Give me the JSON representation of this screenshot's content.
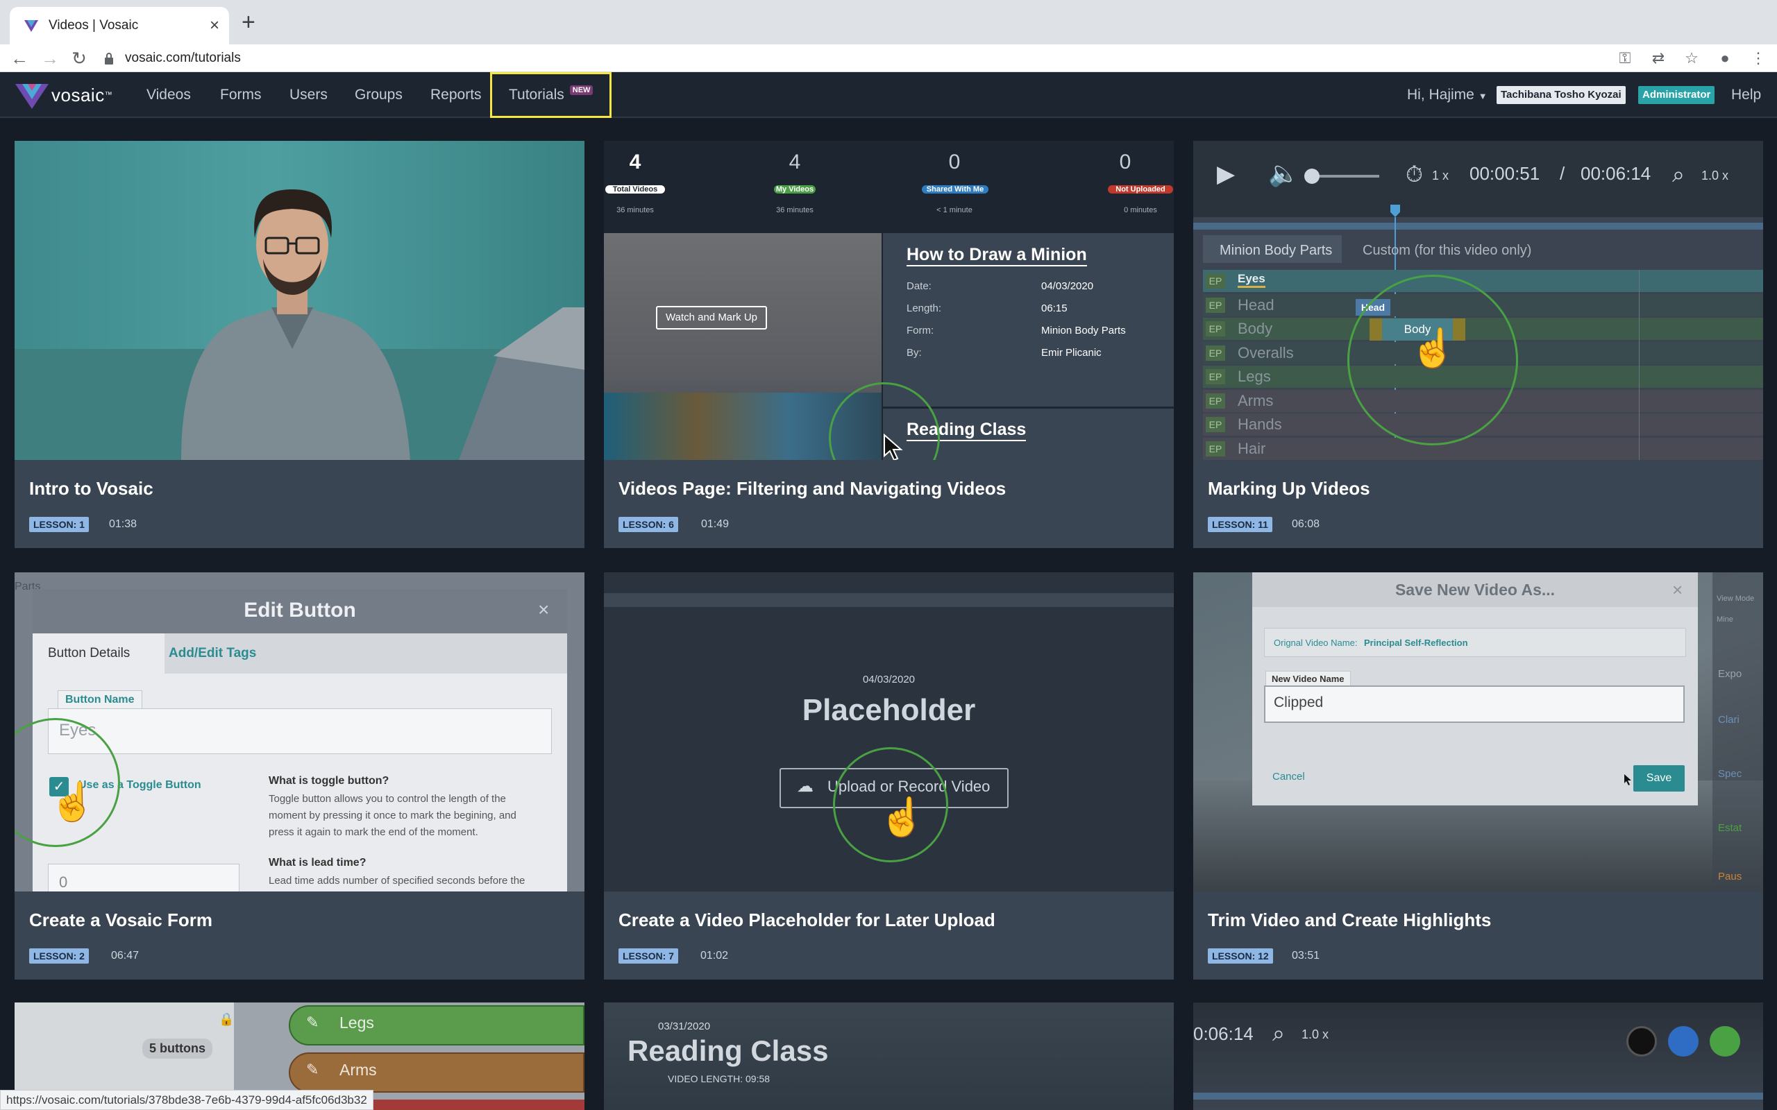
{
  "browser": {
    "tab_title": "Videos | Vosaic",
    "url": "vosaic.com/tutorials",
    "status_url": "https://vosaic.com/tutorials/378bde38-7e6b-4379-99d4-af5fc06d3b32"
  },
  "app": {
    "logo": "vosaic",
    "nav": [
      "Videos",
      "Forms",
      "Users",
      "Groups",
      "Reports"
    ],
    "tutorials_label": "Tutorials",
    "tutorials_badge": "NEW",
    "user_greeting": "Hi, Hajime",
    "org_badge": "Tachibana Tosho Kyozai",
    "role_badge": "Administrator",
    "help": "Help"
  },
  "cards": [
    {
      "title": "Intro to Vosaic",
      "lesson": "LESSON: 1",
      "duration": "01:38"
    },
    {
      "title": "Videos Page: Filtering and Navigating Videos",
      "lesson": "LESSON: 6",
      "duration": "01:49"
    },
    {
      "title": "Marking Up Videos",
      "lesson": "LESSON: 11",
      "duration": "06:08"
    },
    {
      "title": "Create a Vosaic Form",
      "lesson": "LESSON: 2",
      "duration": "06:47"
    },
    {
      "title": "Create a Video Placeholder for Later Upload",
      "lesson": "LESSON: 7",
      "duration": "01:02"
    },
    {
      "title": "Trim Video and Create Highlights",
      "lesson": "LESSON: 12",
      "duration": "03:51"
    }
  ],
  "thumbs": {
    "videos_page": {
      "stats": [
        {
          "num": "4",
          "label": "Total Videos",
          "sub": "36 minutes"
        },
        {
          "num": "4",
          "label": "My Videos",
          "sub": "36 minutes"
        },
        {
          "num": "0",
          "label": "Shared With Me",
          "sub": "< 1 minute"
        },
        {
          "num": "0",
          "label": "Not Uploaded",
          "sub": "0 minutes"
        }
      ],
      "watch_btn": "Watch and Mark Up",
      "video_title": "How to Draw a Minion",
      "details": [
        {
          "k": "Date:",
          "v": "04/03/2020"
        },
        {
          "k": "Length:",
          "v": "06:15"
        },
        {
          "k": "Form:",
          "v": "Minion Body Parts"
        },
        {
          "k": "By:",
          "v": "Emir Plicanic"
        }
      ],
      "next_title": "Reading Class"
    },
    "markup": {
      "speed": "1 x",
      "time": "00:00:51",
      "sep": "/",
      "total": "00:06:14",
      "zoom": "1.0 x",
      "tab1": "Minion Body Parts",
      "tab2": "Custom (for this video only)",
      "ep": "EP",
      "rows": [
        "Eyes",
        "Head",
        "Body",
        "Overalls",
        "Legs",
        "Arms",
        "Hands",
        "Hair"
      ],
      "tag_head": "Head",
      "tag_body": "Body"
    },
    "form": {
      "bg_parts": "Parts",
      "modal_title": "Edit Button",
      "tab1": "Button Details",
      "tab2": "Add/Edit Tags",
      "name_label": "Button Name",
      "name_value": "Eyes",
      "toggle_label": "Use as a Toggle Button",
      "q1": "What is toggle button?",
      "a1": [
        "Toggle button allows you to control the length of the",
        "moment by pressing it once to mark the begining, and",
        "press it again to mark the end of the moment."
      ],
      "q2": "What is lead time?",
      "a2": "Lead time adds number of specified seconds before the",
      "lead_value": "0"
    },
    "placeholder": {
      "date": "04/03/2020",
      "title": "Placeholder",
      "btn": "Upload or Record Video"
    },
    "trim": {
      "modal_title": "Save New Video As...",
      "orig_label": "Orignal Video Name:",
      "orig_value": "Principal Self-Reflection",
      "new_label": "New Video Name",
      "new_value": "Clipped",
      "cancel": "Cancel",
      "save": "Save",
      "side": [
        "View Mode",
        "Mine",
        "Expo",
        "Clari",
        "Spec",
        "Estat",
        "Paus"
      ]
    },
    "partial": {
      "buttons_count": "5 buttons",
      "legs": "Legs",
      "arms": "Arms",
      "reading_date": "03/31/2020",
      "reading_title": "Reading Class",
      "reading_len": "VIDEO LENGTH: 09:58",
      "time": "0:06:14",
      "zoom": "1.0 x"
    }
  },
  "colors": {
    "nav_bg": "#1d2530",
    "card_bg": "#3a4553",
    "lesson_badge": "#8fb7e6",
    "highlight_ring": "#4aa144",
    "tutorials_outline": "#f5e642",
    "admin_badge": "#2aa3a8"
  }
}
